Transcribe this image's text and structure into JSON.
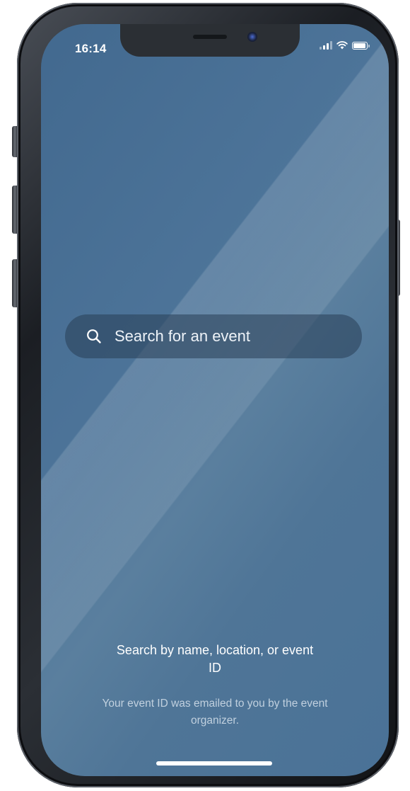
{
  "status_bar": {
    "time": "16:14",
    "battery_level": 1.0
  },
  "search": {
    "placeholder": "Search for an event",
    "icon": "search-icon"
  },
  "help": {
    "title": "Search by name, location, or event ID",
    "subtitle": "Your event ID was emailed to you by the event organizer."
  },
  "colors": {
    "background": "#4a7297",
    "search_bar": "#2f4a66",
    "text": "#ffffff"
  }
}
